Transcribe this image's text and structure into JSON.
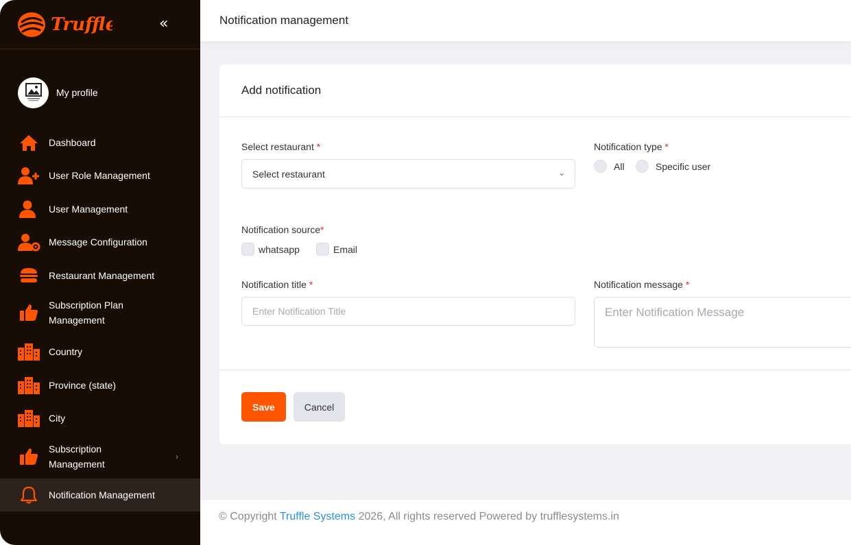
{
  "brand": {
    "name": "Truffle",
    "accent": "#ff5400",
    "sidebar_bg": "#180d05"
  },
  "sidebar": {
    "collapse_icon": "double-chevron-left-icon",
    "profile_label": "My profile",
    "items": [
      {
        "label": "Dashboard",
        "icon": "home-icon"
      },
      {
        "label": "User Role Management",
        "icon": "user-plus-icon"
      },
      {
        "label": "User Management",
        "icon": "user-icon"
      },
      {
        "label": "Message Configuration",
        "icon": "user-gear-icon"
      },
      {
        "label": "Restaurant Management",
        "icon": "burger-icon"
      },
      {
        "label": "Subscription Plan Management",
        "icon": "thumbs-up-icon"
      },
      {
        "label": "Country",
        "icon": "building-icon"
      },
      {
        "label": "Province (state)",
        "icon": "building-icon"
      },
      {
        "label": "City",
        "icon": "building-icon"
      },
      {
        "label": "Subscription Management",
        "icon": "thumbs-up-icon"
      },
      {
        "label": "Notification Management",
        "icon": "bell-icon",
        "active": true
      }
    ]
  },
  "header": {
    "title": "Notification management"
  },
  "form": {
    "title": "Add notification",
    "restaurant": {
      "label": "Select restaurant",
      "required_mark": "*",
      "value": "Select restaurant"
    },
    "notification_type": {
      "label": "Notification type",
      "required_mark": "*",
      "options": [
        "All",
        "Specific user"
      ]
    },
    "notification_source": {
      "label": "Notification source",
      "required_mark": "*",
      "options": [
        "whatsapp",
        "Email"
      ]
    },
    "title_field": {
      "label": "Notification title",
      "required_mark": "*",
      "placeholder": "Enter Notification Title"
    },
    "message_field": {
      "label": "Notification message",
      "required_mark": "*",
      "placeholder": "Enter Notification Message"
    },
    "save_label": "Save",
    "cancel_label": "Cancel"
  },
  "footer": {
    "prefix": "© Copyright ",
    "link": "Truffle Systems",
    "suffix": " 2026, All rights reserved Powered by trufflesystems.in"
  }
}
